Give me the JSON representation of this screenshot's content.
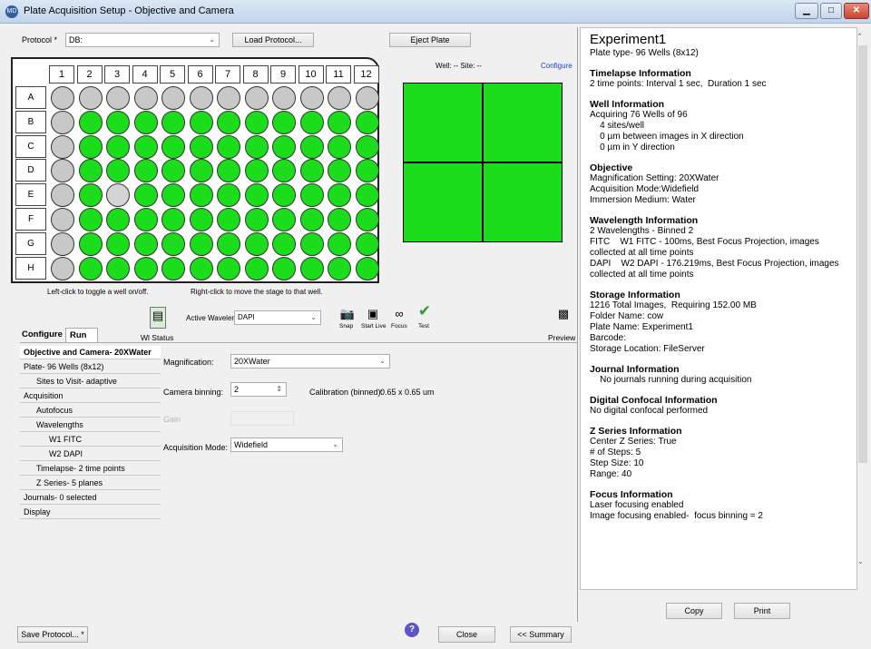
{
  "window": {
    "title": "Plate Acquisition Setup - Objective and Camera",
    "app_icon": "MD"
  },
  "protocol": {
    "label": "Protocol *",
    "value": "DB:",
    "load_button": "Load Protocol...",
    "eject_button": "Eject Plate"
  },
  "plate": {
    "columns": [
      "1",
      "2",
      "3",
      "4",
      "5",
      "6",
      "7",
      "8",
      "9",
      "10",
      "11",
      "12"
    ],
    "rows": [
      "A",
      "B",
      "C",
      "D",
      "E",
      "F",
      "G",
      "H"
    ],
    "disabled_well_row_E_col_2": "E2",
    "hint_left": "Left-click to toggle a well on/off.",
    "hint_right": "Right-click to move the stage to that well."
  },
  "site_view": {
    "well_site": "Well: --  Site: --",
    "configure_link": "Configure"
  },
  "toolbar": {
    "wl_status_label": "Wl Status",
    "active_wavelength_label": "Active Wavelength",
    "active_wavelength_value": "DAPI",
    "snap": "Snap",
    "start_live": "Start Live",
    "focus": "Focus",
    "test": "Test",
    "preview": "Preview"
  },
  "tabs": {
    "configure": "Configure",
    "run": "Run"
  },
  "nav": [
    {
      "label": "Objective and Camera- 20XWater",
      "indent": 0,
      "bold": true
    },
    {
      "label": "Plate- 96 Wells (8x12)",
      "indent": 0
    },
    {
      "label": "Sites to Visit- adaptive",
      "indent": 1
    },
    {
      "label": "Acquisition",
      "indent": 0
    },
    {
      "label": "Autofocus",
      "indent": 1
    },
    {
      "label": "Wavelengths",
      "indent": 1
    },
    {
      "label": "W1 FITC",
      "indent": 2
    },
    {
      "label": "W2 DAPI",
      "indent": 2
    },
    {
      "label": "Timelapse- 2 time points",
      "indent": 1
    },
    {
      "label": "Z Series- 5 planes",
      "indent": 1
    },
    {
      "label": "Journals- 0 selected",
      "indent": 0
    },
    {
      "label": "Display",
      "indent": 0
    }
  ],
  "form": {
    "magnification_label": "Magnification:",
    "magnification_value": "20XWater",
    "binning_label": "Camera binning:",
    "binning_value": "2",
    "calibration_label": "Calibration (binned):",
    "calibration_value": "0.65 x 0.65 um",
    "gain_label": "Gain",
    "acq_mode_label": "Acquisition Mode:",
    "acq_mode_value": "Widefield"
  },
  "summary": {
    "title": "Experiment1",
    "plate_type": "Plate type- 96 Wells (8x12)",
    "sections": [
      {
        "header": "Timelapse Information",
        "lines": [
          "2 time points: Interval 1 sec,  Duration 1 sec"
        ]
      },
      {
        "header": "Well Information",
        "lines": [
          "Acquiring 76 Wells of 96",
          "    4 sites/well",
          "    0 µm between images in X direction",
          "    0 µm in Y direction"
        ]
      },
      {
        "header": "Objective",
        "lines": [
          "Magnification Setting: 20XWater",
          "Acquisition Mode:Widefield",
          "Immersion Medium: Water"
        ]
      },
      {
        "header": "Wavelength Information",
        "lines": [
          "2 Wavelengths - Binned 2",
          "FITC    W1 FITC - 100ms, Best Focus Projection, images collected at all time points",
          "DAPI    W2 DAPI - 176.219ms, Best Focus Projection, images collected at all time points"
        ]
      },
      {
        "header": "Storage Information",
        "lines": [
          "1216 Total Images,  Requiring 152.00 MB",
          "Folder Name: cow",
          "Plate Name: Experiment1",
          "Barcode:",
          "Storage Location: FileServer"
        ]
      },
      {
        "header": "Journal Information",
        "lines": [
          "    No journals running during acquisition"
        ]
      },
      {
        "header": "Digital Confocal Information",
        "lines": [
          "No digital confocal performed"
        ]
      },
      {
        "header": "Z Series Information",
        "lines": [
          "Center Z Series: True",
          "# of Steps: 5",
          "Step Size: 10",
          "Range: 40"
        ]
      },
      {
        "header": "Focus Information",
        "lines": [
          "Laser focusing enabled",
          "Image focusing enabled-  focus binning = 2"
        ]
      }
    ],
    "copy_button": "Copy",
    "print_button": "Print"
  },
  "footer": {
    "save_button": "Save Protocol... *",
    "help_icon": "?",
    "close_button": "Close",
    "summary_button": "<< Summary"
  },
  "colors": {
    "well_on": "#1cdd1c",
    "well_off": "#c8c8c8",
    "title_bar": "#c2d4ec"
  }
}
